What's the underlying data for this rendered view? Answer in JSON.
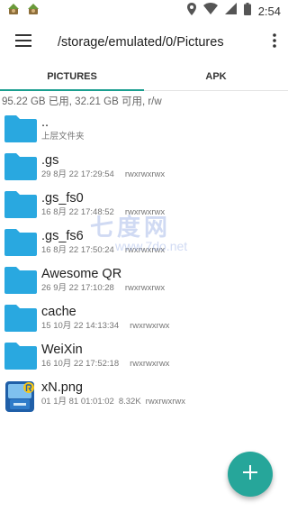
{
  "status_bar": {
    "time": "2:54",
    "left_icons": [
      "app-notification-icon",
      "app-notification-icon"
    ],
    "right_icons": [
      "location-icon",
      "wifi-icon",
      "signal-icon",
      "battery-icon"
    ]
  },
  "toolbar": {
    "path": "/storage/emulated/0/Pictures",
    "menu_icon": "hamburger-icon",
    "more_icon": "overflow-menu-icon"
  },
  "tabs": [
    {
      "label": "PICTURES",
      "active": true
    },
    {
      "label": "APK",
      "active": false
    }
  ],
  "storage_info": "95.22 GB 已用, 32.21 GB 可用, r/w",
  "files": [
    {
      "name": "..",
      "date": "上层文件夹",
      "size": "",
      "perms": "",
      "icon": "folder-icon"
    },
    {
      "name": ".gs",
      "date": "29 8月 22 17:29:54",
      "size": "",
      "perms": "rwxrwxrwx",
      "icon": "folder-icon"
    },
    {
      "name": ".gs_fs0",
      "date": "16 8月 22 17:48:52",
      "size": "",
      "perms": "rwxrwxrwx",
      "icon": "folder-icon"
    },
    {
      "name": ".gs_fs6",
      "date": "16 8月 22 17:50:24",
      "size": "",
      "perms": "rwxrwxrwx",
      "icon": "folder-icon"
    },
    {
      "name": "Awesome QR",
      "date": "26 9月 22 17:10:28",
      "size": "",
      "perms": "rwxrwxrwx",
      "icon": "folder-icon"
    },
    {
      "name": "cache",
      "date": "15 10月 22 14:13:34",
      "size": "",
      "perms": "rwxrwxrwx",
      "icon": "folder-icon"
    },
    {
      "name": "WeiXin",
      "date": "16 10月 22 17:52:18",
      "size": "",
      "perms": "rwxrwxrwx",
      "icon": "folder-icon"
    },
    {
      "name": "xN.png",
      "date": "01 1月 81 01:01:02",
      "size": "8.32K",
      "perms": "rwxrwxrwx",
      "icon": "image-file-icon"
    }
  ],
  "fab": {
    "icon": "plus-icon"
  },
  "watermark": {
    "text": "七度网",
    "url": "www.7do.net"
  },
  "colors": {
    "accent": "#26a69a",
    "folder": "#29a8e0",
    "tab_indicator": "#1a9e8f"
  }
}
